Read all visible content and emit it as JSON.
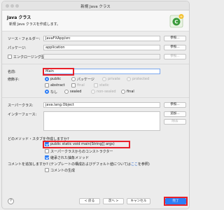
{
  "window": {
    "title": "新規 Java クラス"
  },
  "header": {
    "title": "Java クラス",
    "description": "新規 Java クラスを作成します。"
  },
  "form": {
    "source_folder": {
      "label": "ソース・フォルダー:",
      "value": "JavaFXApp/src",
      "button": "参照..."
    },
    "package": {
      "label": "パッケージ:",
      "value": "application",
      "button": "参照..."
    },
    "enclosing_type": {
      "label": "エンクロージング型:",
      "value": "",
      "button": "参照...",
      "checked": false
    },
    "name": {
      "label": "名前:",
      "value": "Main"
    },
    "modifiers": {
      "label": "修飾子:",
      "access": {
        "public": {
          "label": "public",
          "selected": true
        },
        "package": {
          "label": "パッケージ",
          "selected": false
        },
        "private": {
          "label": "private",
          "selected": false
        },
        "protected": {
          "label": "protected",
          "selected": false
        }
      },
      "flags": {
        "abstract": {
          "label": "abstract",
          "checked": false
        },
        "final": {
          "label": "final",
          "checked": false
        },
        "static": {
          "label": "static",
          "checked": false
        }
      },
      "sealed": {
        "none": {
          "label": "なし",
          "selected": true
        },
        "sealed": {
          "label": "sealed",
          "selected": false
        },
        "non_sealed": {
          "label": "non-sealed",
          "selected": false
        },
        "final": {
          "label": "final",
          "selected": false
        }
      }
    },
    "superclass": {
      "label": "スーパークラス:",
      "value": "java.lang.Object",
      "button": "参照..."
    },
    "interfaces": {
      "label": "インターフェース:",
      "add_button": "追加...",
      "remove_button": "除去"
    },
    "stubs": {
      "question": "どのメソッド・スタブを作成しますか?",
      "main": {
        "label": "public static void main(String[] args)",
        "checked": true
      },
      "constructors": {
        "label": "スーパークラスからのコンストラクター",
        "checked": false
      },
      "inherited": {
        "label": "継承された抽象メソッド",
        "checked": true
      }
    },
    "comments": {
      "question_prefix": "コメントを追加しますか? (テンプレートの構成およびデフォルト値については",
      "question_link": "ここ",
      "question_suffix": "を参照)",
      "generate": {
        "label": "コメントの生成",
        "checked": false
      }
    }
  },
  "footer": {
    "help": "?",
    "back": "< 戻る",
    "next": "次へ >",
    "cancel": "キャンセル",
    "finish": "完了"
  },
  "colors": {
    "accent": "#2d7ef6",
    "highlight": "#e8202a"
  }
}
